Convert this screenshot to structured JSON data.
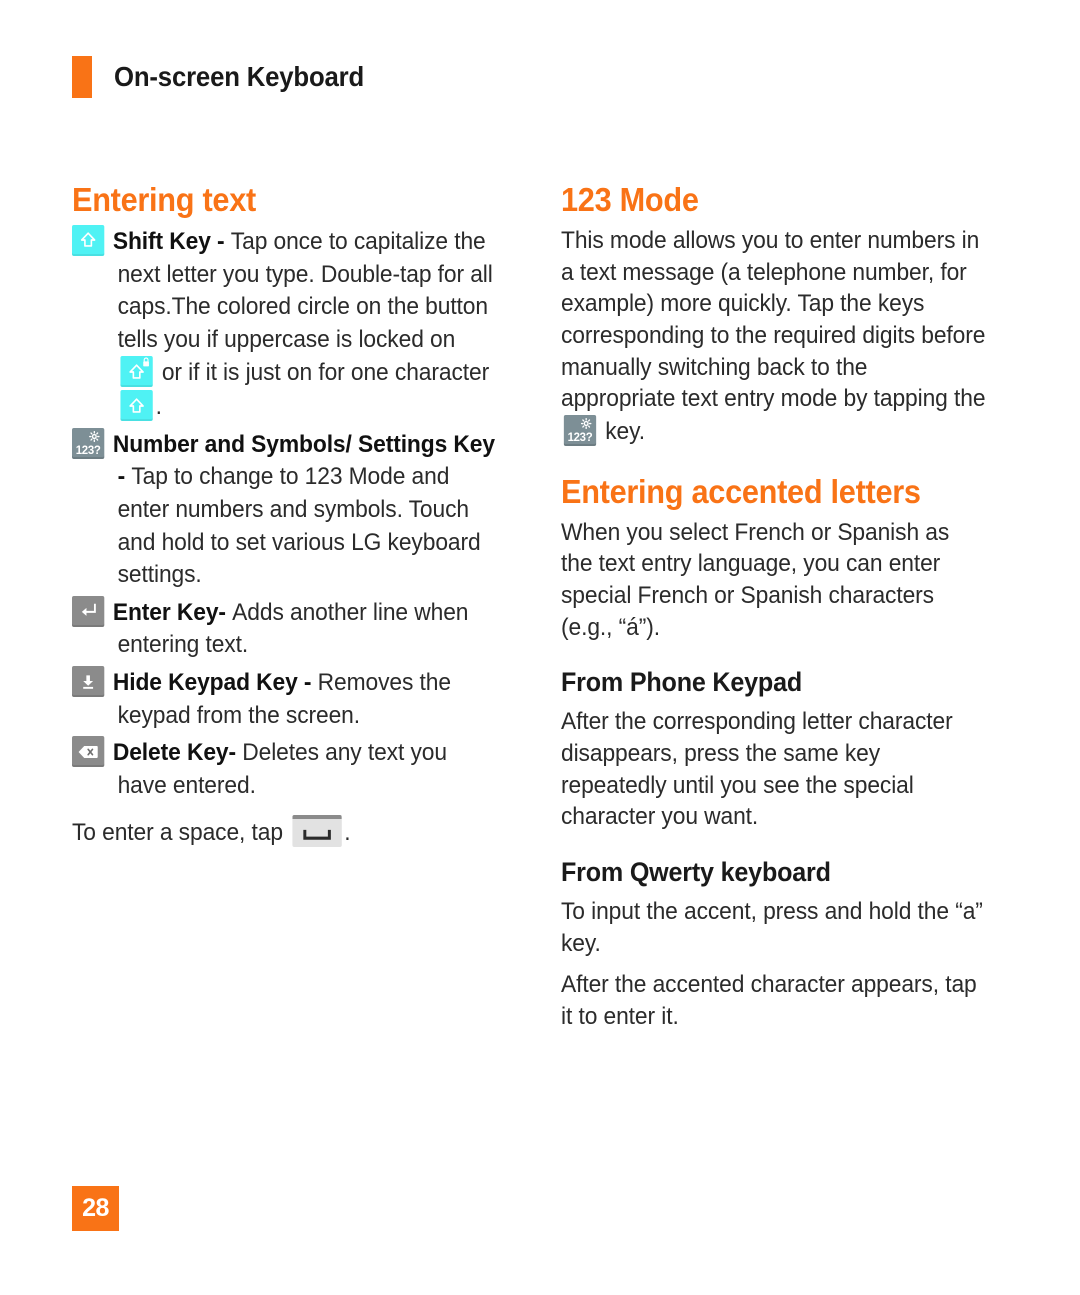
{
  "header": {
    "title": "On-screen Keyboard",
    "accent_color": "#f97316"
  },
  "left_column": {
    "section_title": "Entering text",
    "entries": [
      {
        "icon": "shift-key-icon",
        "term": "Shift Key - ",
        "text_before": "Tap once to capitalize the next letter you type. Double-tap for all caps.The colored circle on the button tells you if uppercase is locked on ",
        "text_middle": " or if it is just on for one character ",
        "text_after": "."
      },
      {
        "icon": "number-symbols-settings-key-icon",
        "term": "Number and Symbols/ Settings Key - ",
        "text": "Tap to change to 123 Mode and enter numbers and symbols. Touch and hold to set various LG keyboard settings."
      },
      {
        "icon": "enter-key-icon",
        "term": "Enter Key- ",
        "text": "Adds another line when entering text."
      },
      {
        "icon": "hide-keypad-key-icon",
        "term": "Hide Keypad Key - ",
        "text": "Removes the keypad from the screen."
      },
      {
        "icon": "delete-key-icon",
        "term": "Delete Key- ",
        "text": "Deletes any text you have entered."
      }
    ],
    "space_note_before": "To enter a space, tap ",
    "space_note_after": "."
  },
  "right_column": {
    "mode_title": "123 Mode",
    "mode_text_before": "This mode allows you to enter numbers in a text message (a telephone number, for example) more quickly. Tap the keys corresponding to the required digits before manually switching back to the appropriate text entry mode by tapping the ",
    "mode_text_after": " key.",
    "accented_title": "Entering accented letters",
    "accented_text": "When you select French or Spanish as the text entry language, you can enter special French or Spanish characters (e.g., “á”).",
    "phone_keypad_title": "From Phone Keypad",
    "phone_keypad_text": "After the corresponding letter character disappears, press the same key repeatedly until you see the special character you want.",
    "qwerty_title": "From Qwerty keyboard",
    "qwerty_text_1": "To input the accent, press and hold the “a” key.",
    "qwerty_text_2": "After the accented character appears, tap it to enter it."
  },
  "key_labels": {
    "number_key_text": "123?"
  },
  "footer": {
    "page_number": "28"
  }
}
